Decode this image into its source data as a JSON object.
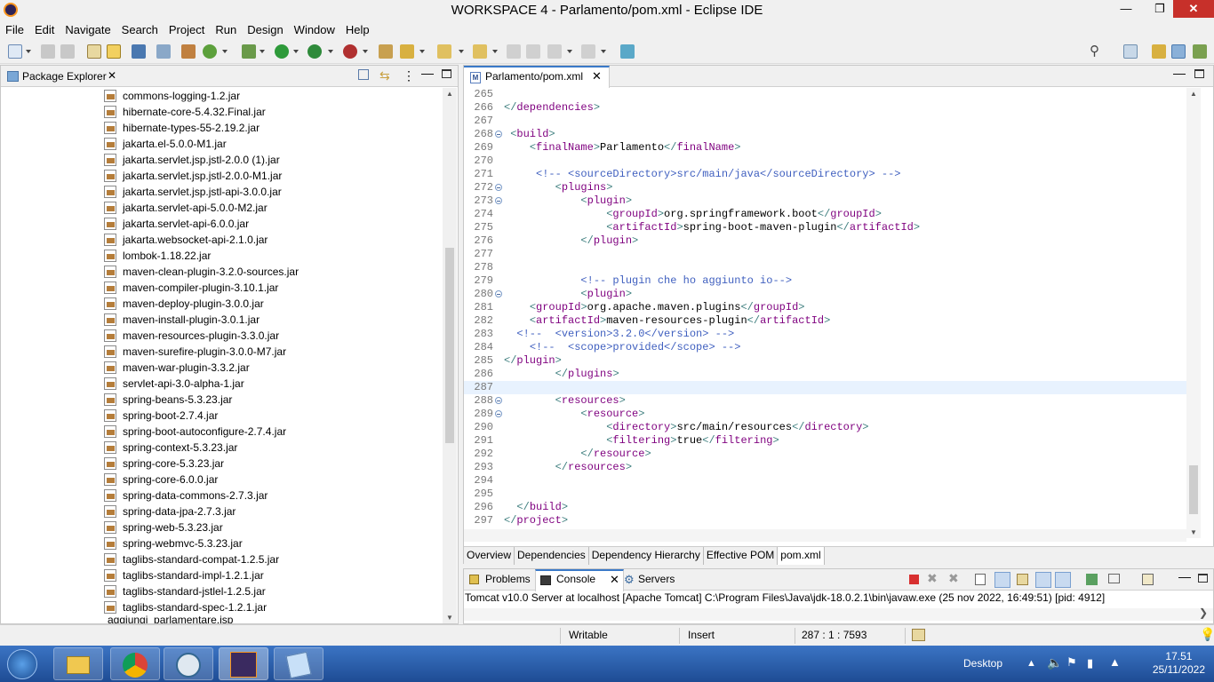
{
  "window": {
    "title": "WORKSPACE 4 - Parlamento/pom.xml - Eclipse IDE"
  },
  "menu": [
    "File",
    "Edit",
    "Navigate",
    "Search",
    "Project",
    "Run",
    "Design",
    "Window",
    "Help"
  ],
  "package_explorer": {
    "title": "Package Explorer",
    "items": [
      "commons-logging-1.2.jar",
      "hibernate-core-5.4.32.Final.jar",
      "hibernate-types-55-2.19.2.jar",
      "jakarta.el-5.0.0-M1.jar",
      "jakarta.servlet.jsp.jstl-2.0.0 (1).jar",
      "jakarta.servlet.jsp.jstl-2.0.0-M1.jar",
      "jakarta.servlet.jsp.jstl-api-3.0.0.jar",
      "jakarta.servlet-api-5.0.0-M2.jar",
      "jakarta.servlet-api-6.0.0.jar",
      "jakarta.websocket-api-2.1.0.jar",
      "lombok-1.18.22.jar",
      "maven-clean-plugin-3.2.0-sources.jar",
      "maven-compiler-plugin-3.10.1.jar",
      "maven-deploy-plugin-3.0.0.jar",
      "maven-install-plugin-3.0.1.jar",
      "maven-resources-plugin-3.3.0.jar",
      "maven-surefire-plugin-3.0.0-M7.jar",
      "maven-war-plugin-3.3.2.jar",
      "servlet-api-3.0-alpha-1.jar",
      "spring-beans-5.3.23.jar",
      "spring-boot-2.7.4.jar",
      "spring-boot-autoconfigure-2.7.4.jar",
      "spring-context-5.3.23.jar",
      "spring-core-5.3.23.jar",
      "spring-core-6.0.0.jar",
      "spring-data-commons-2.7.3.jar",
      "spring-data-jpa-2.7.3.jar",
      "spring-web-5.3.23.jar",
      "spring-webmvc-5.3.23.jar",
      "taglibs-standard-compat-1.2.5.jar",
      "taglibs-standard-impl-1.2.1.jar",
      "taglibs-standard-jstlel-1.2.5.jar",
      "taglibs-standard-spec-1.2.1.jar"
    ],
    "partial_item": "aggiungi_parlamentare.jsp"
  },
  "editor": {
    "tab_label": "Parlamento/pom.xml",
    "lines": [
      {
        "n": "265",
        "fold": false,
        "html": ""
      },
      {
        "n": "266",
        "fold": false,
        "html": "</dependencies>"
      },
      {
        "n": "267",
        "fold": false,
        "html": ""
      },
      {
        "n": "268",
        "fold": true,
        "html": " <build>"
      },
      {
        "n": "269",
        "fold": false,
        "html": "    <finalName>Parlamento</finalName>"
      },
      {
        "n": "270",
        "fold": false,
        "html": ""
      },
      {
        "n": "271",
        "fold": false,
        "html": "     <!-- <sourceDirectory>src/main/java</sourceDirectory> -->"
      },
      {
        "n": "272",
        "fold": true,
        "html": "        <plugins>"
      },
      {
        "n": "273",
        "fold": true,
        "html": "            <plugin>"
      },
      {
        "n": "274",
        "fold": false,
        "html": "                <groupId>org.springframework.boot</groupId>"
      },
      {
        "n": "275",
        "fold": false,
        "html": "                <artifactId>spring-boot-maven-plugin</artifactId>"
      },
      {
        "n": "276",
        "fold": false,
        "html": "            </plugin>"
      },
      {
        "n": "277",
        "fold": false,
        "html": ""
      },
      {
        "n": "278",
        "fold": false,
        "html": ""
      },
      {
        "n": "279",
        "fold": false,
        "html": "            <!-- plugin che ho aggiunto io-->"
      },
      {
        "n": "280",
        "fold": true,
        "html": "            <plugin>"
      },
      {
        "n": "281",
        "fold": false,
        "html": "    <groupId>org.apache.maven.plugins</groupId>"
      },
      {
        "n": "282",
        "fold": false,
        "html": "    <artifactId>maven-resources-plugin</artifactId>"
      },
      {
        "n": "283",
        "fold": false,
        "html": "  <!--  <version>3.2.0</version> -->"
      },
      {
        "n": "284",
        "fold": false,
        "html": "    <!--  <scope>provided</scope> -->"
      },
      {
        "n": "285",
        "fold": false,
        "html": "</plugin>"
      },
      {
        "n": "286",
        "fold": false,
        "html": "        </plugins>"
      },
      {
        "n": "287",
        "fold": false,
        "html": ""
      },
      {
        "n": "288",
        "fold": true,
        "html": "        <resources>"
      },
      {
        "n": "289",
        "fold": true,
        "html": "            <resource>"
      },
      {
        "n": "290",
        "fold": false,
        "html": "                <directory>src/main/resources</directory>"
      },
      {
        "n": "291",
        "fold": false,
        "html": "                <filtering>true</filtering>"
      },
      {
        "n": "292",
        "fold": false,
        "html": "            </resource>"
      },
      {
        "n": "293",
        "fold": false,
        "html": "        </resources>"
      },
      {
        "n": "294",
        "fold": false,
        "html": ""
      },
      {
        "n": "295",
        "fold": false,
        "html": ""
      },
      {
        "n": "296",
        "fold": false,
        "html": "  </build>"
      },
      {
        "n": "297",
        "fold": false,
        "html": "</project>"
      }
    ],
    "current_line": "287",
    "pom_tabs": [
      "Overview",
      "Dependencies",
      "Dependency Hierarchy",
      "Effective POM",
      "pom.xml"
    ],
    "active_pom_tab": "pom.xml"
  },
  "console": {
    "tabs": [
      "Problems",
      "Console",
      "Servers"
    ],
    "active_tab": "Console",
    "line": "Tomcat v10.0 Server at localhost [Apache Tomcat] C:\\Program Files\\Java\\jdk-18.0.2.1\\bin\\javaw.exe  (25 nov 2022, 16:49:51) [pid: 4912]"
  },
  "status": {
    "writable": "Writable",
    "insert": "Insert",
    "position": "287 : 1 : 7593"
  },
  "taskbar": {
    "desktop": "Desktop",
    "time": "17.51",
    "date": "25/11/2022"
  },
  "colors": {
    "tag": "#3f7f7f",
    "attr": "#7f007f",
    "comment": "#3f5fbf",
    "taskbar": "#2b5fa8"
  }
}
